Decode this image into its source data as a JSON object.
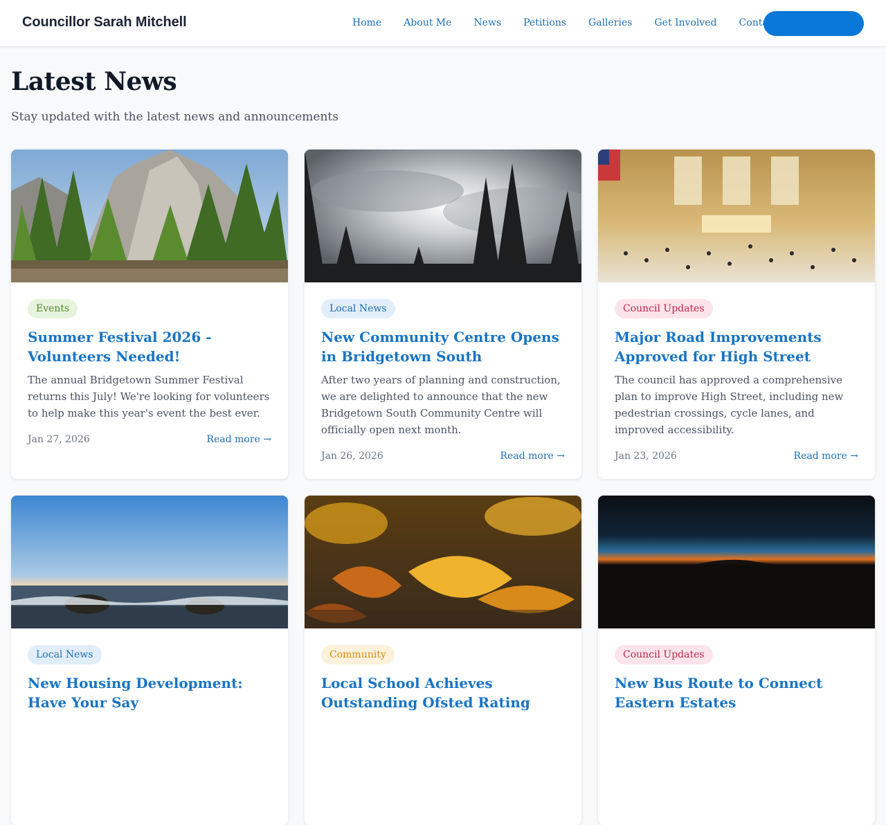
{
  "nav": {
    "brand": "Councillor Sarah Mitchell",
    "links": [
      "Home",
      "About Me",
      "News",
      "Petitions",
      "Galleries",
      "Get Involved",
      "Contact"
    ],
    "accent": "#0a78d8"
  },
  "page": {
    "title": "Latest News",
    "subtitle": "Stay updated with the latest news and announcements"
  },
  "tag_colors": {
    "Events": {
      "bg": "#e6f4dd",
      "fg": "#4d8a26"
    },
    "Local News": {
      "bg": "#e1eefa",
      "fg": "#1c6eb5"
    },
    "Council Updates": {
      "bg": "#fce4ea",
      "fg": "#c7224a"
    },
    "Community": {
      "bg": "#fdf1dc",
      "fg": "#d88c12"
    }
  },
  "articles": [
    {
      "tag": "Events",
      "title": "Summer Festival 2026 - Volunteers Needed!",
      "excerpt": "The annual Bridgetown Summer Festival returns this July! We're looking for volunteers to help make this year's event the best ever.",
      "date": "Jan 27, 2026",
      "read_more": "Read more →",
      "image": "forest-mountain-photo"
    },
    {
      "tag": "Local News",
      "title": "New Community Centre Opens in Bridgetown South",
      "excerpt": "After two years of planning and construction, we are delighted to announce that the new Bridgetown South Community Centre will officially open next month.",
      "date": "Jan 26, 2026",
      "read_more": "Read more →",
      "image": "misty-trees-photo"
    },
    {
      "tag": "Council Updates",
      "title": "Major Road Improvements Approved for High Street",
      "excerpt": "The council has approved a comprehensive plan to improve High Street, including new pedestrian crossings, cycle lanes, and improved accessibility.",
      "date": "Jan 23, 2026",
      "read_more": "Read more →",
      "image": "train-station-photo"
    },
    {
      "tag": "Local News",
      "title": "New Housing Development: Have Your Say",
      "excerpt": "",
      "date": "",
      "read_more": "",
      "image": "ocean-waves-photo"
    },
    {
      "tag": "Community",
      "title": "Local School Achieves Outstanding Ofsted Rating",
      "excerpt": "",
      "date": "",
      "read_more": "",
      "image": "autumn-leaves-photo"
    },
    {
      "tag": "Council Updates",
      "title": "New Bus Route to Connect Eastern Estates",
      "excerpt": "",
      "date": "",
      "read_more": "",
      "image": "night-horizon-photo"
    }
  ]
}
